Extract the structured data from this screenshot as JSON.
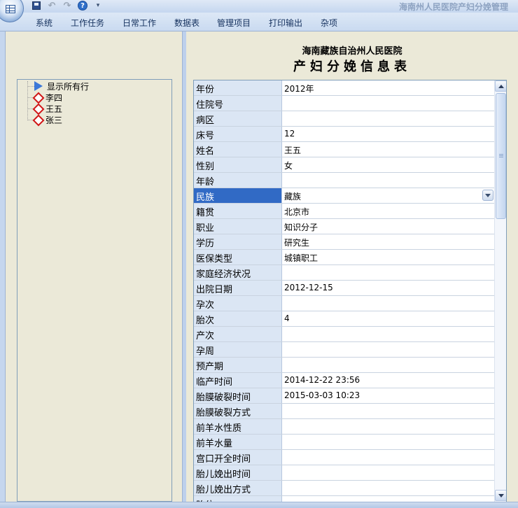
{
  "window": {
    "title": "海南州人民医院产妇分娩管理"
  },
  "quick_access": {
    "icons": [
      "app-orb-icon",
      "save-icon",
      "undo-icon",
      "redo-icon",
      "help-icon",
      "customize-qat-icon"
    ]
  },
  "menu": [
    {
      "label": "系统"
    },
    {
      "label": "工作任务"
    },
    {
      "label": "日常工作"
    },
    {
      "label": "数据表"
    },
    {
      "label": "管理项目"
    },
    {
      "label": "打印输出"
    },
    {
      "label": "杂项"
    }
  ],
  "tree": {
    "show_all_label": "显示所有行",
    "items": [
      {
        "label": "李四"
      },
      {
        "label": "王五"
      },
      {
        "label": "张三"
      }
    ]
  },
  "form": {
    "hospital": "海南藏族自治州人民医院",
    "title": "产妇分娩信息表",
    "selected_field": "民族",
    "rows": [
      {
        "label": "年份",
        "value": "2012年"
      },
      {
        "label": "住院号",
        "value": ""
      },
      {
        "label": "病区",
        "value": ""
      },
      {
        "label": "床号",
        "value": "12"
      },
      {
        "label": "姓名",
        "value": "王五"
      },
      {
        "label": "性别",
        "value": "女"
      },
      {
        "label": "年龄",
        "value": ""
      },
      {
        "label": "民族",
        "value": "藏族"
      },
      {
        "label": "籍贯",
        "value": "北京市"
      },
      {
        "label": "职业",
        "value": "知识分子"
      },
      {
        "label": "学历",
        "value": "研究生"
      },
      {
        "label": "医保类型",
        "value": "城镇职工"
      },
      {
        "label": "家庭经济状况",
        "value": ""
      },
      {
        "label": "出院日期",
        "value": "2012-12-15"
      },
      {
        "label": "孕次",
        "value": ""
      },
      {
        "label": "胎次",
        "value": "4"
      },
      {
        "label": "产次",
        "value": ""
      },
      {
        "label": "孕周",
        "value": ""
      },
      {
        "label": "预产期",
        "value": ""
      },
      {
        "label": "临产时间",
        "value": "2014-12-22 23:56"
      },
      {
        "label": "胎膜破裂时间",
        "value": "2015-03-03 10:23"
      },
      {
        "label": "胎膜破裂方式",
        "value": ""
      },
      {
        "label": "前羊水性质",
        "value": ""
      },
      {
        "label": "前羊水量",
        "value": ""
      },
      {
        "label": "宫口开全时间",
        "value": ""
      },
      {
        "label": "胎儿娩出时间",
        "value": ""
      },
      {
        "label": "胎儿娩出方式",
        "value": ""
      },
      {
        "label": "胎位",
        "value": ""
      }
    ]
  },
  "colors": {
    "selected_label_bg": "#316ac5",
    "label_bg": "#dbe6f4",
    "panel_bg": "#ebe9d8",
    "ribbon_bg": "#c9daf0"
  }
}
